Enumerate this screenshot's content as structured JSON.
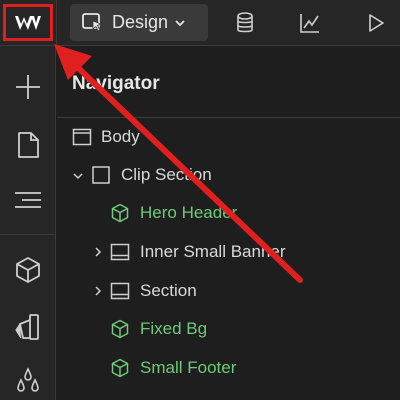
{
  "topbar": {
    "mode_label": "Design",
    "icons": [
      "webflow-logo-icon",
      "pointer-icon",
      "chevron-down-icon",
      "database-icon",
      "chart-icon",
      "play-icon"
    ]
  },
  "rail": {
    "icons": [
      "plus-icon",
      "page-icon",
      "navigator-icon",
      "cube-icon",
      "style-manager-icon",
      "drops-icon"
    ]
  },
  "navigator": {
    "title": "Navigator",
    "items": [
      {
        "label": "Body",
        "type": "body",
        "color": "#d9d9d9"
      },
      {
        "label": "Clip Section",
        "type": "div",
        "color": "#d9d9d9"
      },
      {
        "label": "Hero Header",
        "type": "component",
        "color": "#6fca79"
      },
      {
        "label": "Inner Small Banner",
        "type": "section",
        "color": "#d9d9d9"
      },
      {
        "label": "Section",
        "type": "section",
        "color": "#d9d9d9"
      },
      {
        "label": "Fixed Bg",
        "type": "component",
        "color": "#6fca79"
      },
      {
        "label": "Small Footer",
        "type": "component",
        "color": "#6fca79"
      }
    ]
  },
  "colors": {
    "accent_red": "#e0201f",
    "component_green": "#6fca79",
    "panel_bg": "#1e1e1e",
    "bar_bg": "#262626"
  }
}
